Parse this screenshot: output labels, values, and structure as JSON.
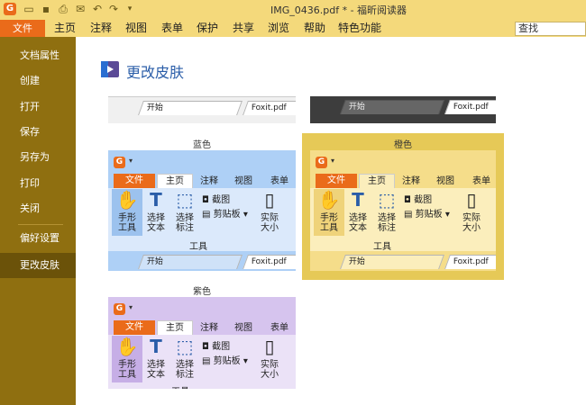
{
  "window": {
    "title": "IMG_0436.pdf * - 福昕阅读器"
  },
  "quick_access": {
    "icons": [
      "foxit-logo-icon",
      "open-folder-icon",
      "save-icon",
      "print-icon",
      "email-icon",
      "undo-icon",
      "redo-icon",
      "customize-arrow-icon"
    ]
  },
  "menubar": {
    "file": "文件",
    "items": [
      "主页",
      "注释",
      "视图",
      "表单",
      "保护",
      "共享",
      "浏览",
      "帮助",
      "特色功能"
    ],
    "search_placeholder": "查找"
  },
  "sidebar": {
    "items": [
      "文档属性",
      "创建",
      "打开",
      "保存",
      "另存为",
      "打印",
      "关闭",
      "偏好设置",
      "更改皮肤"
    ],
    "active": "更改皮肤"
  },
  "page": {
    "heading": "更改皮肤"
  },
  "colors": {
    "accent_orange": "#ea6b1a",
    "titlebar": "#f4d97b",
    "sidebar": "#8f6f10",
    "blue_skin": "#aed0f6",
    "orange_skin": "#e6c957",
    "purple_skin": "#d6c4ee"
  },
  "skins": {
    "top_partial": {
      "tab_start": "开始",
      "tab_file": "Foxit.pdf"
    },
    "blue": {
      "label": "蓝色",
      "ribbon_tabs": [
        "文件",
        "主页",
        "注释",
        "视图",
        "表单"
      ],
      "tools": {
        "hand": "手形工具",
        "select_text": "选择文本",
        "select_note": "选择标注",
        "screenshot": "截图",
        "clipboard": "剪贴板",
        "actual_size": "实际大小",
        "group_label": "工具"
      },
      "tab_start": "开始",
      "tab_file": "Foxit.pdf"
    },
    "orange": {
      "label": "橙色",
      "ribbon_tabs": [
        "文件",
        "主页",
        "注释",
        "视图",
        "表单"
      ],
      "tools": {
        "hand": "手形工具",
        "select_text": "选择文本",
        "select_note": "选择标注",
        "screenshot": "截图",
        "clipboard": "剪贴板",
        "actual_size": "实际大小",
        "group_label": "工具"
      },
      "tab_start": "开始",
      "tab_file": "Foxit.pdf"
    },
    "purple": {
      "label": "紫色",
      "ribbon_tabs": [
        "文件",
        "主页",
        "注释",
        "视图",
        "表单"
      ],
      "tools": {
        "hand": "手形工具",
        "select_text": "选择文本",
        "select_note": "选择标注",
        "screenshot": "截图",
        "clipboard": "剪贴板",
        "actual_size": "实际大小",
        "group_label": "工具"
      }
    }
  }
}
